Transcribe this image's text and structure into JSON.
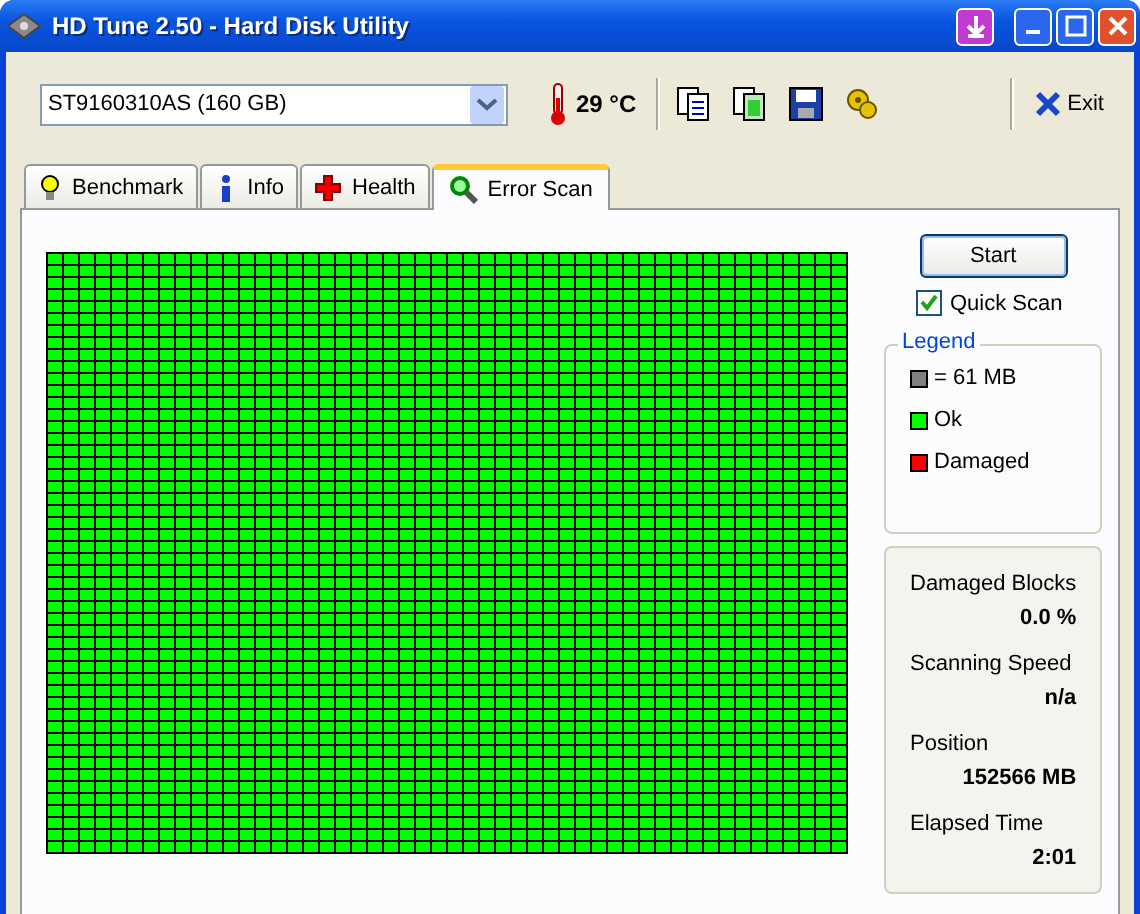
{
  "window": {
    "title": "HD Tune 2.50 - Hard Disk Utility"
  },
  "drive_select": {
    "value": "ST9160310AS (160 GB)"
  },
  "temperature": "29 °C",
  "exit_button": "Exit",
  "tabs": [
    {
      "label": "Benchmark",
      "kind": "bulb",
      "selected": false
    },
    {
      "label": "Info",
      "kind": "info",
      "selected": false
    },
    {
      "label": "Health",
      "kind": "cross",
      "selected": false
    },
    {
      "label": "Error Scan",
      "kind": "magnifier",
      "selected": true
    }
  ],
  "start_button": "Start",
  "quick_scan": {
    "label": "Quick Scan",
    "checked": true
  },
  "legend": {
    "title": "Legend",
    "items": [
      {
        "label": "= 61 MB",
        "color": "#808080"
      },
      {
        "label": "Ok",
        "color": "#00ff00"
      },
      {
        "label": "Damaged",
        "color": "#ff0000"
      }
    ]
  },
  "stats": [
    {
      "label": "Damaged Blocks",
      "value": "0.0 %"
    },
    {
      "label": "Scanning Speed",
      "value": "n/a"
    },
    {
      "label": "Position",
      "value": "152566 MB"
    },
    {
      "label": "Elapsed Time",
      "value": "2:01"
    }
  ]
}
